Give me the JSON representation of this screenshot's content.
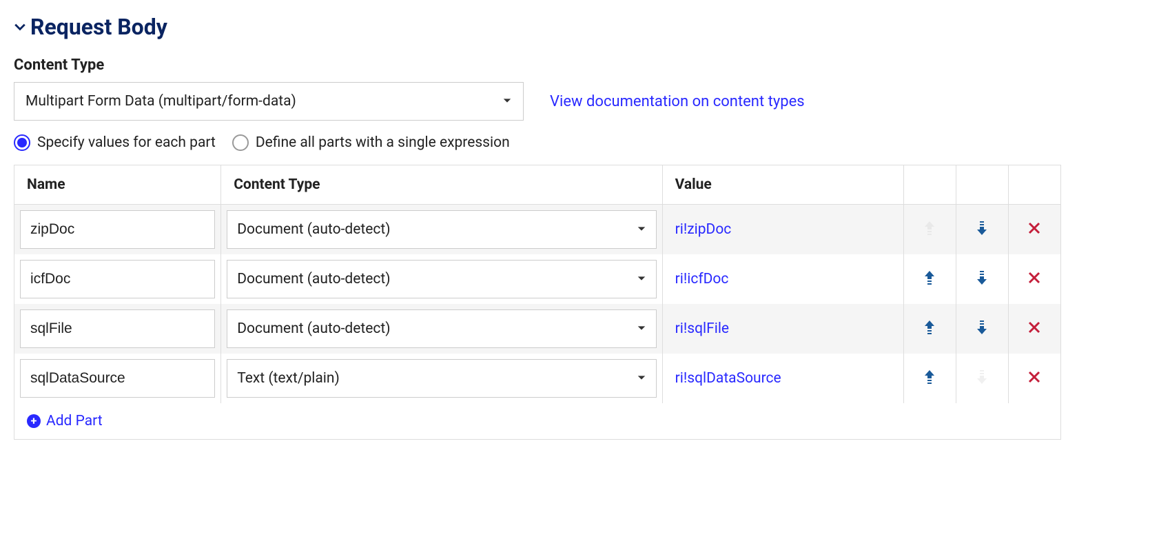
{
  "section": {
    "title": "Request Body"
  },
  "content_type": {
    "label": "Content Type",
    "value": "Multipart Form Data (multipart/form-data)",
    "doc_link": "View documentation on content types"
  },
  "radio": {
    "option1": "Specify values for each part",
    "option2": "Define all parts with a single expression"
  },
  "table": {
    "headers": {
      "name": "Name",
      "content_type": "Content Type",
      "value": "Value"
    },
    "rows": [
      {
        "name": "zipDoc",
        "content_type": "Document (auto-detect)",
        "value": "ri!zipDoc",
        "up_enabled": false,
        "down_enabled": true
      },
      {
        "name": "icfDoc",
        "content_type": "Document (auto-detect)",
        "value": "ri!icfDoc",
        "up_enabled": true,
        "down_enabled": true
      },
      {
        "name": "sqlFile",
        "content_type": "Document (auto-detect)",
        "value": "ri!sqlFile",
        "up_enabled": true,
        "down_enabled": true
      },
      {
        "name": "sqlDataSource",
        "content_type": "Text (text/plain)",
        "value": "ri!sqlDataSource",
        "up_enabled": true,
        "down_enabled": false
      }
    ],
    "add_part": "Add Part"
  }
}
